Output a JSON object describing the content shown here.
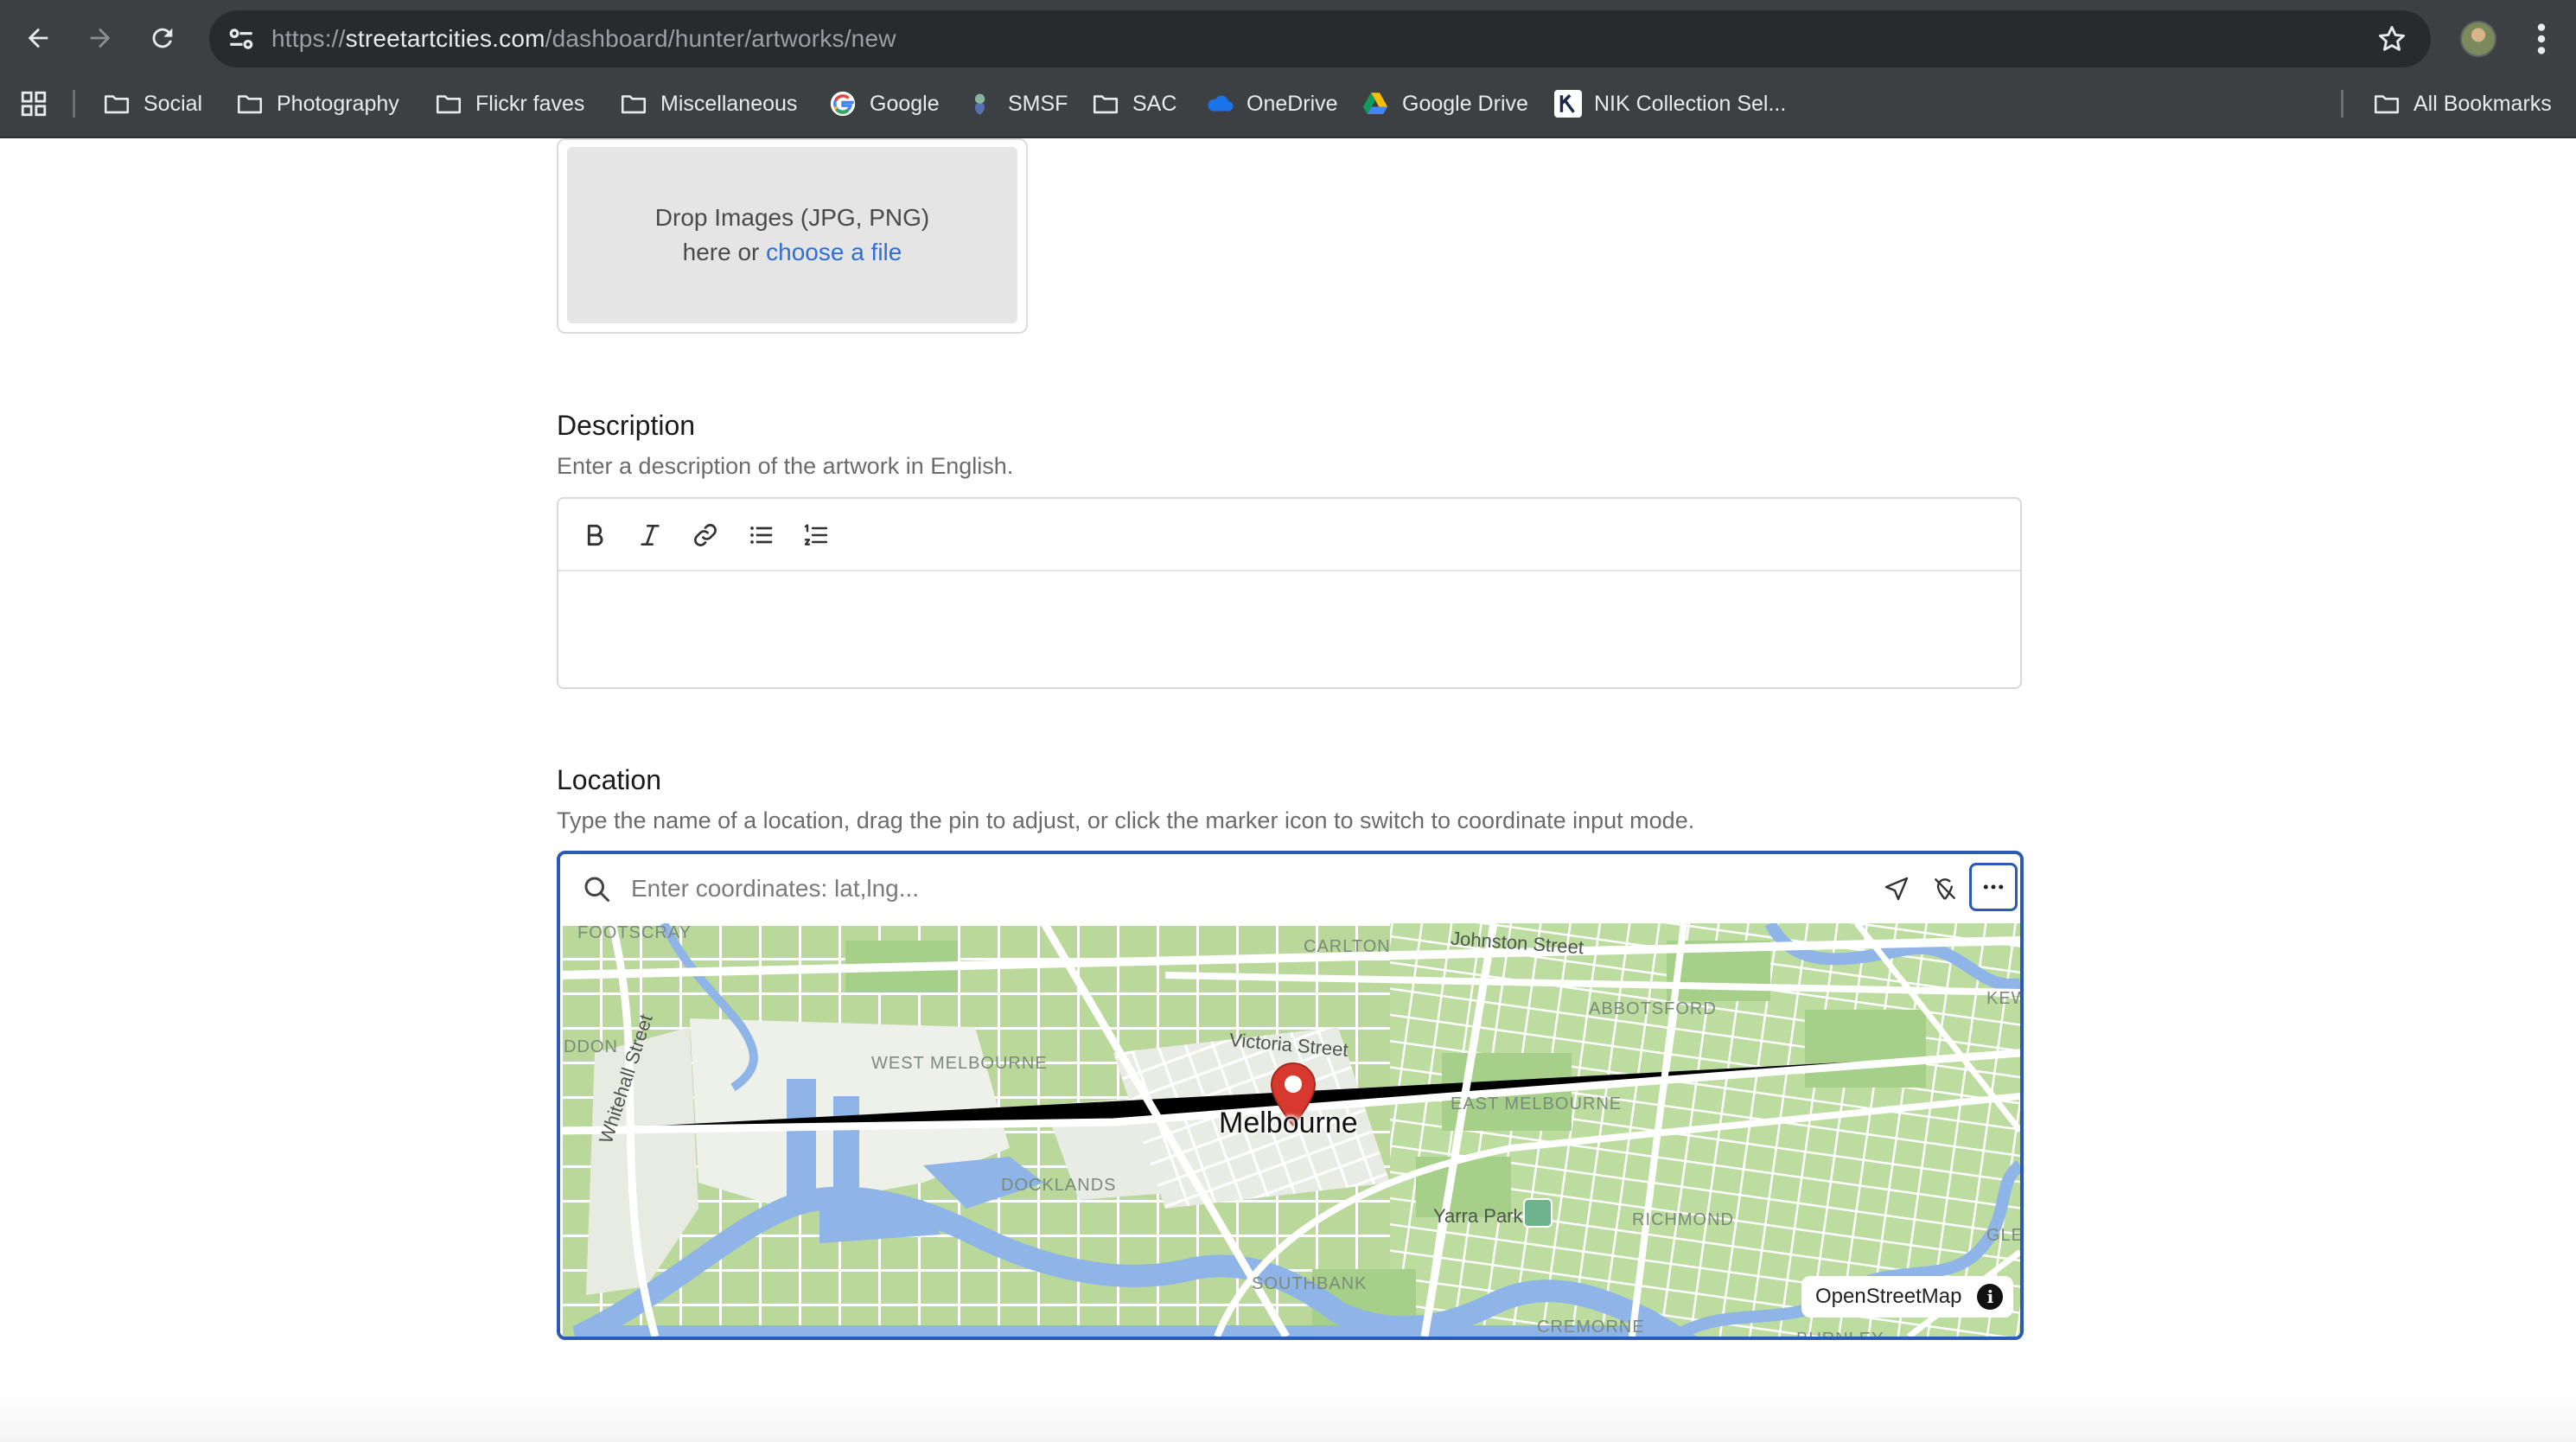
{
  "browser": {
    "url_prefix": "https://",
    "url_host": "streetartcities.com",
    "url_path": "/dashboard/hunter/artworks/new",
    "bookmarks": [
      {
        "label": "Social",
        "icon": "folder-icon"
      },
      {
        "label": "Photography",
        "icon": "folder-icon"
      },
      {
        "label": "Flickr faves",
        "icon": "folder-icon"
      },
      {
        "label": "Miscellaneous",
        "icon": "folder-icon"
      },
      {
        "label": "Google",
        "icon": "google-icon"
      },
      {
        "label": "SMSF",
        "icon": "smsf-icon"
      },
      {
        "label": "SAC",
        "icon": "folder-icon"
      },
      {
        "label": "OneDrive",
        "icon": "onedrive-icon"
      },
      {
        "label": "Google Drive",
        "icon": "google-drive-icon"
      },
      {
        "label": "NIK Collection Sel...",
        "icon": "nik-icon"
      }
    ],
    "all_bookmarks": "All Bookmarks"
  },
  "upload": {
    "line1": "Drop Images (JPG, PNG)",
    "line2_prefix": "here or ",
    "line2_link": "choose a file"
  },
  "description": {
    "title": "Description",
    "help": "Enter a description of the artwork in English.",
    "toolbar": [
      "bold-icon",
      "italic-icon",
      "link-icon",
      "bullet-list-icon",
      "numbered-list-icon"
    ]
  },
  "location": {
    "title": "Location",
    "help": "Type the name of a location, drag the pin to adjust, or click the marker icon to switch to coordinate input mode.",
    "placeholder": "Enter coordinates: lat,lng...",
    "map": {
      "city": "Melbourne",
      "attribution": "OpenStreetMap",
      "areas": [
        "FOOTSCRAY",
        "CARLTON",
        "ABBOTSFORD",
        "WEST MELBOURNE",
        "EAST MELBOURNE",
        "DOCKLANDS",
        "RICHMOND",
        "SOUTHBANK",
        "CREMORNE",
        "BURNLEY",
        "KEW",
        "GLENI",
        "DDON"
      ],
      "streets": [
        "Johnston Street",
        "Victoria Street",
        "Whitehall Street",
        "Yarra Park"
      ]
    }
  },
  "colors": {
    "chrome": "#3c4043",
    "accent_blue": "#2b59b7",
    "link_blue": "#2f6ed6",
    "map_green": "#b9d89a",
    "map_water": "#8fb4e8",
    "pin_red": "#d7392f"
  }
}
